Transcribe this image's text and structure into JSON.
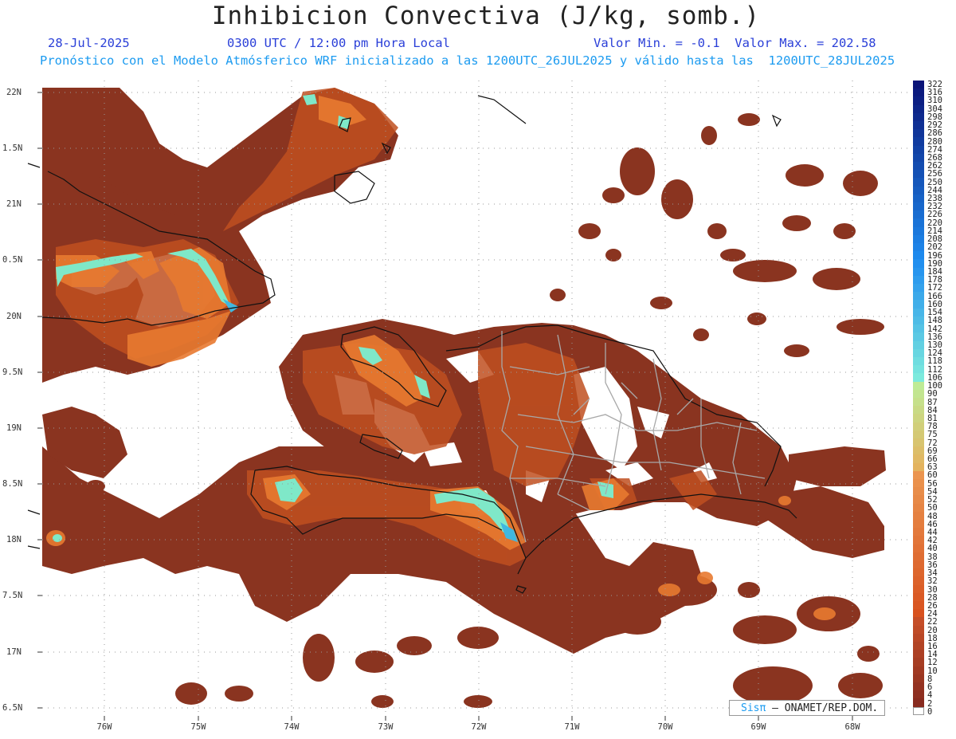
{
  "header": {
    "title": "Inhibicion Convectiva (J/kg, somb.)",
    "date": "28-Jul-2025",
    "time": "0300 UTC / 12:00 pm Hora Local",
    "minmax": "Valor Min. = -0.1  Valor Max. = 202.58",
    "forecast_note": "Pronóstico con el Modelo Atmósferico WRF inicializado a las 1200UTC_26JUL2025 y válido hasta las  1200UTC_28JUL2025"
  },
  "axes": {
    "lat_labels": [
      "22N",
      "1.5N",
      "21N",
      "0.5N",
      "20N",
      "9.5N",
      "19N",
      "8.5N",
      "18N",
      "7.5N",
      "17N",
      "6.5N"
    ],
    "lon_labels": [
      "76W",
      "75W",
      "74W",
      "73W",
      "72W",
      "71W",
      "70W",
      "69W",
      "68W"
    ]
  },
  "colorbar": {
    "labels": [
      "322",
      "316",
      "310",
      "304",
      "298",
      "292",
      "286",
      "280",
      "274",
      "268",
      "262",
      "256",
      "250",
      "244",
      "238",
      "232",
      "226",
      "220",
      "214",
      "208",
      "202",
      "196",
      "190",
      "184",
      "178",
      "172",
      "166",
      "160",
      "154",
      "148",
      "142",
      "136",
      "130",
      "124",
      "118",
      "112",
      "106",
      "100",
      "90",
      "87",
      "84",
      "81",
      "78",
      "75",
      "72",
      "69",
      "66",
      "63",
      "60",
      "56",
      "54",
      "52",
      "50",
      "48",
      "46",
      "44",
      "42",
      "40",
      "38",
      "36",
      "34",
      "32",
      "30",
      "28",
      "26",
      "24",
      "22",
      "20",
      "18",
      "16",
      "14",
      "12",
      "10",
      "8",
      "6",
      "4",
      "2",
      "0"
    ]
  },
  "credit": {
    "sis": "Sisπ",
    "text": "– ONAMET/REP.DOM."
  },
  "colors": {
    "field_base": "#8a3420",
    "field_mid": "#c05020",
    "field_high": "#e87a30",
    "field_peak": "#7fe8c8",
    "coast": "#111111",
    "province": "#a0a0a0",
    "title_blue": "#2a3fd8",
    "subtitle_cyan": "#1c9bf0"
  }
}
